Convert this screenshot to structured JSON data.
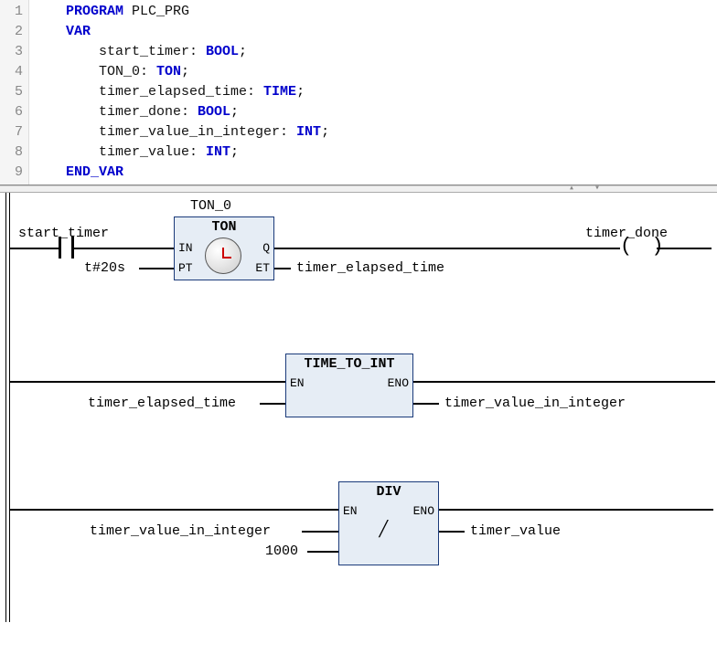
{
  "editor": {
    "lines": [
      "1",
      "2",
      "3",
      "4",
      "5",
      "6",
      "7",
      "8",
      "9"
    ],
    "l1_kw": "PROGRAM",
    "l1_id": " PLC_PRG",
    "l2_kw": "VAR",
    "l3_id": "        start_timer: ",
    "l3_ty": "BOOL",
    "l3_end": ";",
    "l4_id": "        TON_0: ",
    "l4_ty": "TON",
    "l4_end": ";",
    "l5_id": "        timer_elapsed_time: ",
    "l5_ty": "TIME",
    "l5_end": ";",
    "l6_id": "        timer_done: ",
    "l6_ty": "BOOL",
    "l6_end": ";",
    "l7_id": "        timer_value_in_integer: ",
    "l7_ty": "INT",
    "l7_end": ";",
    "l8_id": "        timer_value: ",
    "l8_ty": "INT",
    "l8_end": ";",
    "l9_kw": "END_VAR"
  },
  "rung1": {
    "instance": "TON_0",
    "block": "TON",
    "pin_in": "IN",
    "pin_q": "Q",
    "pin_pt": "PT",
    "pin_et": "ET",
    "contact": "start_timer",
    "pt_val": "t#20s",
    "et_out": "timer_elapsed_time",
    "coil": "timer_done"
  },
  "rung2": {
    "block": "TIME_TO_INT",
    "pin_en": "EN",
    "pin_eno": "ENO",
    "in": "timer_elapsed_time",
    "out": "timer_value_in_integer"
  },
  "rung3": {
    "block": "DIV",
    "pin_en": "EN",
    "pin_eno": "ENO",
    "in1": "timer_value_in_integer",
    "in2": "1000",
    "out": "timer_value"
  }
}
